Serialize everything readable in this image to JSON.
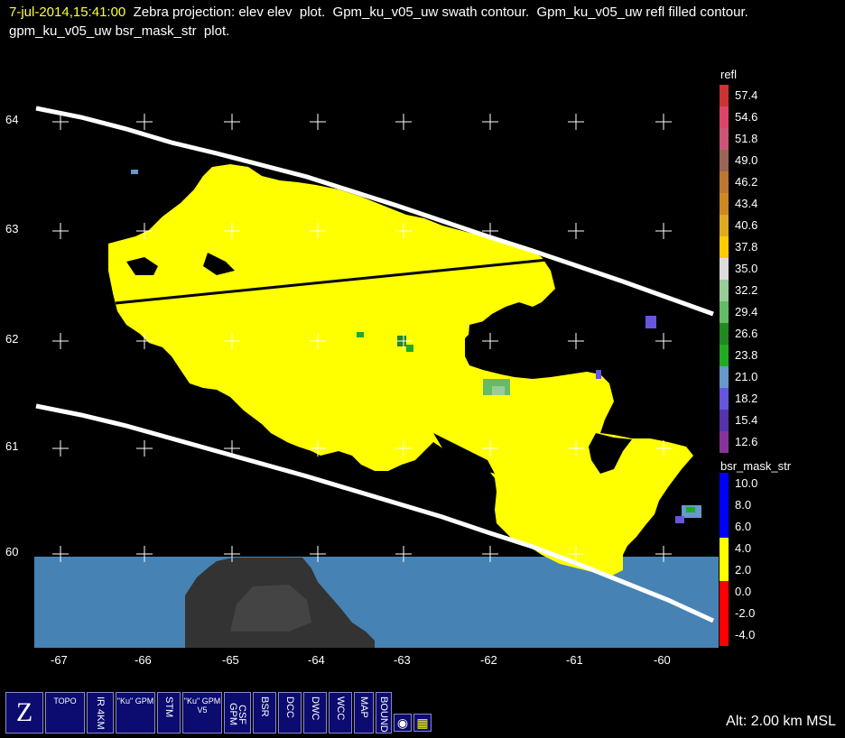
{
  "title": {
    "timestamp": "7-jul-2014,15:41:00",
    "text": "  Zebra projection: elev elev  plot.  Gpm_ku_v05_uw swath contour.  Gpm_ku_v05_uw refl filled contour.  gpm_ku_v05_uw bsr_mask_str  plot."
  },
  "axes": {
    "y_ticks": [
      "64",
      "63",
      "62",
      "61",
      "60"
    ],
    "x_ticks": [
      "-67",
      "-66",
      "-65",
      "-64",
      "-63",
      "-62",
      "-61",
      "-60"
    ]
  },
  "colors": {
    "background": "#000000",
    "precip": "#ffff00",
    "surface": "#4682b4",
    "land": "#333333",
    "swath": "#ffffff",
    "grid": "#ffffff"
  },
  "colorbar_refl": {
    "title": "refl",
    "entries": [
      {
        "label": "57.4",
        "color": "#cc3333"
      },
      {
        "label": "54.6",
        "color": "#dd4466"
      },
      {
        "label": "51.8",
        "color": "#cc5577"
      },
      {
        "label": "49.0",
        "color": "#996655"
      },
      {
        "label": "46.2",
        "color": "#bb7733"
      },
      {
        "label": "43.4",
        "color": "#cc8822"
      },
      {
        "label": "40.6",
        "color": "#ddaa22"
      },
      {
        "label": "37.8",
        "color": "#ffcc00"
      },
      {
        "label": "35.0",
        "color": "#dddddd"
      },
      {
        "label": "32.2",
        "color": "#99cc99"
      },
      {
        "label": "29.4",
        "color": "#66bb66"
      },
      {
        "label": "26.6",
        "color": "#228822"
      },
      {
        "label": "23.8",
        "color": "#22aa22"
      },
      {
        "label": "21.0",
        "color": "#6699cc"
      },
      {
        "label": "18.2",
        "color": "#6655dd"
      },
      {
        "label": "15.4",
        "color": "#5533aa"
      },
      {
        "label": "12.6",
        "color": "#883399"
      }
    ]
  },
  "colorbar_mask": {
    "title": "bsr_mask_str",
    "entries": [
      {
        "label": "10.0",
        "color": "#0000ff"
      },
      {
        "label": "8.0",
        "color": "#0000ff"
      },
      {
        "label": "6.0",
        "color": "#0000ff"
      },
      {
        "label": "4.0",
        "color": "#ffff00"
      },
      {
        "label": "2.0",
        "color": "#ffff00"
      },
      {
        "label": "0.0",
        "color": "#ff0000"
      },
      {
        "label": "-2.0",
        "color": "#ff0000"
      },
      {
        "label": "-4.0",
        "color": "#ff0000"
      }
    ]
  },
  "toolbar": [
    {
      "name": "zebra-logo-button",
      "label": "Z"
    },
    {
      "name": "topo-button",
      "label": "TOPO"
    },
    {
      "name": "ir-4km-button",
      "label": "IR 4KM"
    },
    {
      "name": "ku-gpm-button",
      "label": "\"Ku\" GPM"
    },
    {
      "name": "stm-button",
      "label": "STM"
    },
    {
      "name": "ku-gpm-v5-button",
      "label": "\"Ku\" GPM V5"
    },
    {
      "name": "csf-gpm-button",
      "label": "CSF GPM"
    },
    {
      "name": "bsr-button",
      "label": "BSR"
    },
    {
      "name": "dcc-button",
      "label": "DCC"
    },
    {
      "name": "dwc-button",
      "label": "DWC"
    },
    {
      "name": "wcc-button",
      "label": "WCC"
    },
    {
      "name": "map-button",
      "label": "MAP"
    },
    {
      "name": "bounds-button",
      "label": "BOUNDS"
    }
  ],
  "status": {
    "altitude": "Alt: 2.00 km MSL"
  }
}
